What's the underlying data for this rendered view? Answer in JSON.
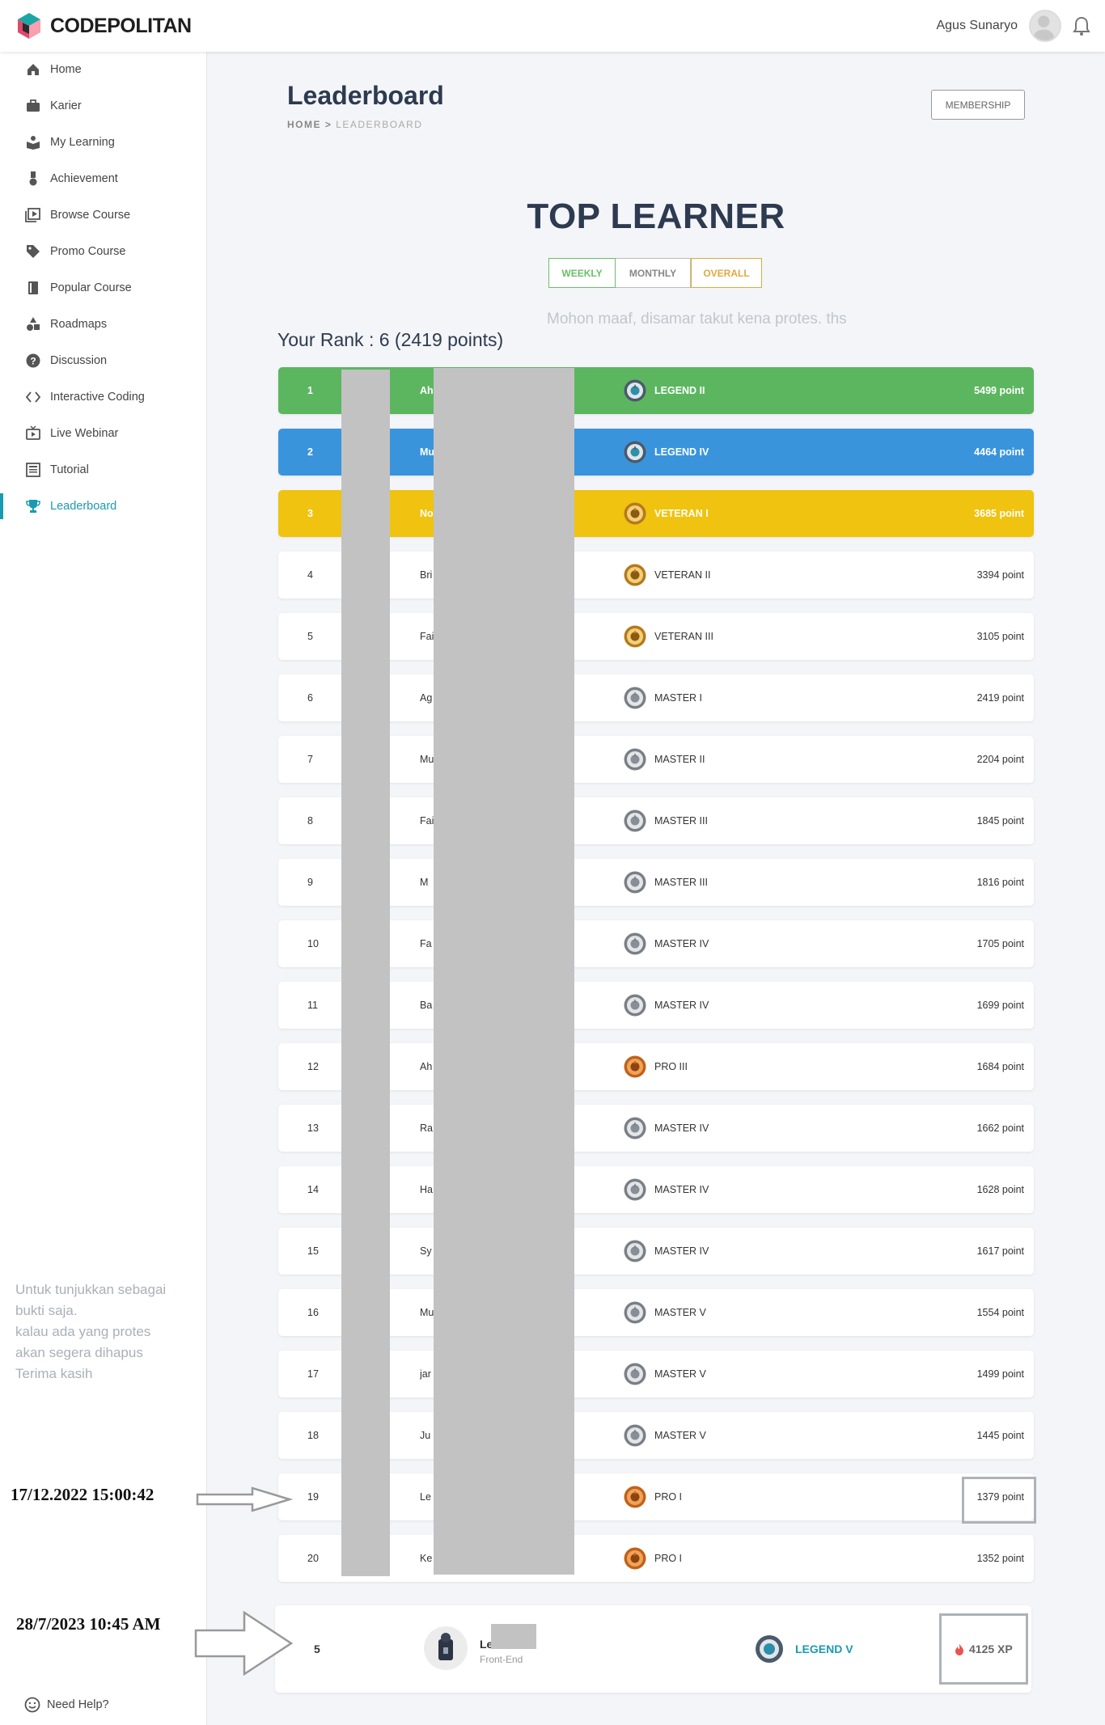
{
  "header": {
    "logo_text": "CODEPOLITAN",
    "user_name": "Agus Sunaryo"
  },
  "sidebar": {
    "items": [
      {
        "label": "Home",
        "icon": "home-icon"
      },
      {
        "label": "Karier",
        "icon": "briefcase-icon"
      },
      {
        "label": "My Learning",
        "icon": "book-reader-icon"
      },
      {
        "label": "Achievement",
        "icon": "medal-icon"
      },
      {
        "label": "Browse Course",
        "icon": "video-library-icon"
      },
      {
        "label": "Promo Course",
        "icon": "tag-icon"
      },
      {
        "label": "Popular Course",
        "icon": "book-icon"
      },
      {
        "label": "Roadmaps",
        "icon": "shapes-icon"
      },
      {
        "label": "Discussion",
        "icon": "question-icon"
      },
      {
        "label": "Interactive Coding",
        "icon": "code-icon"
      },
      {
        "label": "Live Webinar",
        "icon": "tv-icon"
      },
      {
        "label": "Tutorial",
        "icon": "newspaper-icon"
      },
      {
        "label": "Leaderboard",
        "icon": "trophy-icon"
      }
    ],
    "active": "Leaderboard",
    "note": [
      "Untuk tunjukkan sebagai",
      "bukti saja.",
      "kalau ada yang protes",
      "akan segera dihapus",
      "Terima kasih"
    ],
    "help_label": "Need Help?"
  },
  "page": {
    "title": "Leaderboard",
    "breadcrumb_home": "HOME",
    "breadcrumb_sep": ">",
    "breadcrumb_current": "LEADERBOARD",
    "membership_label": "MEMBERSHIP",
    "heading": "TOP LEARNER",
    "tabs": [
      "WEEKLY",
      "MONTHLY",
      "OVERALL"
    ],
    "notice": "Mohon maaf, disamar takut kena protes. ths",
    "your_rank": "Your Rank : 6 (2419 points)"
  },
  "colors": {
    "first": "#5cb660",
    "second": "#3a94dc",
    "third": "#efc30f",
    "accent": "#1a9ab0"
  },
  "leaderboard": [
    {
      "rank": "1",
      "name": "Ah",
      "tier": "LEGEND II",
      "points": "5499 point",
      "badge": "legend"
    },
    {
      "rank": "2",
      "name": "Mu",
      "tier": "LEGEND IV",
      "points": "4464 point",
      "badge": "legend"
    },
    {
      "rank": "3",
      "name": "No",
      "tier": "VETERAN I",
      "points": "3685 point",
      "badge": "veteran"
    },
    {
      "rank": "4",
      "name": "Bri",
      "tier": "VETERAN II",
      "points": "3394 point",
      "badge": "veteran"
    },
    {
      "rank": "5",
      "name": "Fai",
      "tier": "VETERAN III",
      "points": "3105 point",
      "badge": "veteran"
    },
    {
      "rank": "6",
      "name": "Ag",
      "tier": "MASTER I",
      "points": "2419 point",
      "badge": "master"
    },
    {
      "rank": "7",
      "name": "Mu",
      "tier": "MASTER II",
      "points": "2204 point",
      "badge": "master"
    },
    {
      "rank": "8",
      "name": "Fai",
      "tier": "MASTER III",
      "points": "1845 point",
      "badge": "master"
    },
    {
      "rank": "9",
      "name": "M",
      "tier": "MASTER III",
      "points": "1816 point",
      "badge": "master"
    },
    {
      "rank": "10",
      "name": "Fa",
      "tier": "MASTER IV",
      "points": "1705 point",
      "badge": "master"
    },
    {
      "rank": "11",
      "name": "Ba",
      "tier": "MASTER IV",
      "points": "1699 point",
      "badge": "master"
    },
    {
      "rank": "12",
      "name": "Ah",
      "tier": "PRO III",
      "points": "1684 point",
      "badge": "pro"
    },
    {
      "rank": "13",
      "name": "Ra",
      "tier": "MASTER IV",
      "points": "1662 point",
      "badge": "master"
    },
    {
      "rank": "14",
      "name": "Ha",
      "tier": "MASTER IV",
      "points": "1628 point",
      "badge": "master"
    },
    {
      "rank": "15",
      "name": "Sy",
      "tier": "MASTER IV",
      "points": "1617 point",
      "badge": "master"
    },
    {
      "rank": "16",
      "name": "Mu",
      "tier": "MASTER V",
      "points": "1554 point",
      "badge": "master"
    },
    {
      "rank": "17",
      "name": "jar",
      "tier": "MASTER V",
      "points": "1499 point",
      "badge": "master"
    },
    {
      "rank": "18",
      "name": "Ju",
      "tier": "MASTER V",
      "points": "1445 point",
      "badge": "master"
    },
    {
      "rank": "19",
      "name": "Le",
      "tier": "PRO I",
      "points": "1379 point",
      "badge": "pro"
    },
    {
      "rank": "20",
      "name": "Ke",
      "tier": "PRO I",
      "points": "1352 point",
      "badge": "pro"
    }
  ],
  "my_entry": {
    "rank": "5",
    "name": "Le",
    "role": "Front-End",
    "tier": "LEGEND V",
    "xp": "4125 XP"
  },
  "annotations": {
    "stamp1": "17/12.2022  15:00:42",
    "stamp2": "28/7/2023 10:45 AM"
  }
}
